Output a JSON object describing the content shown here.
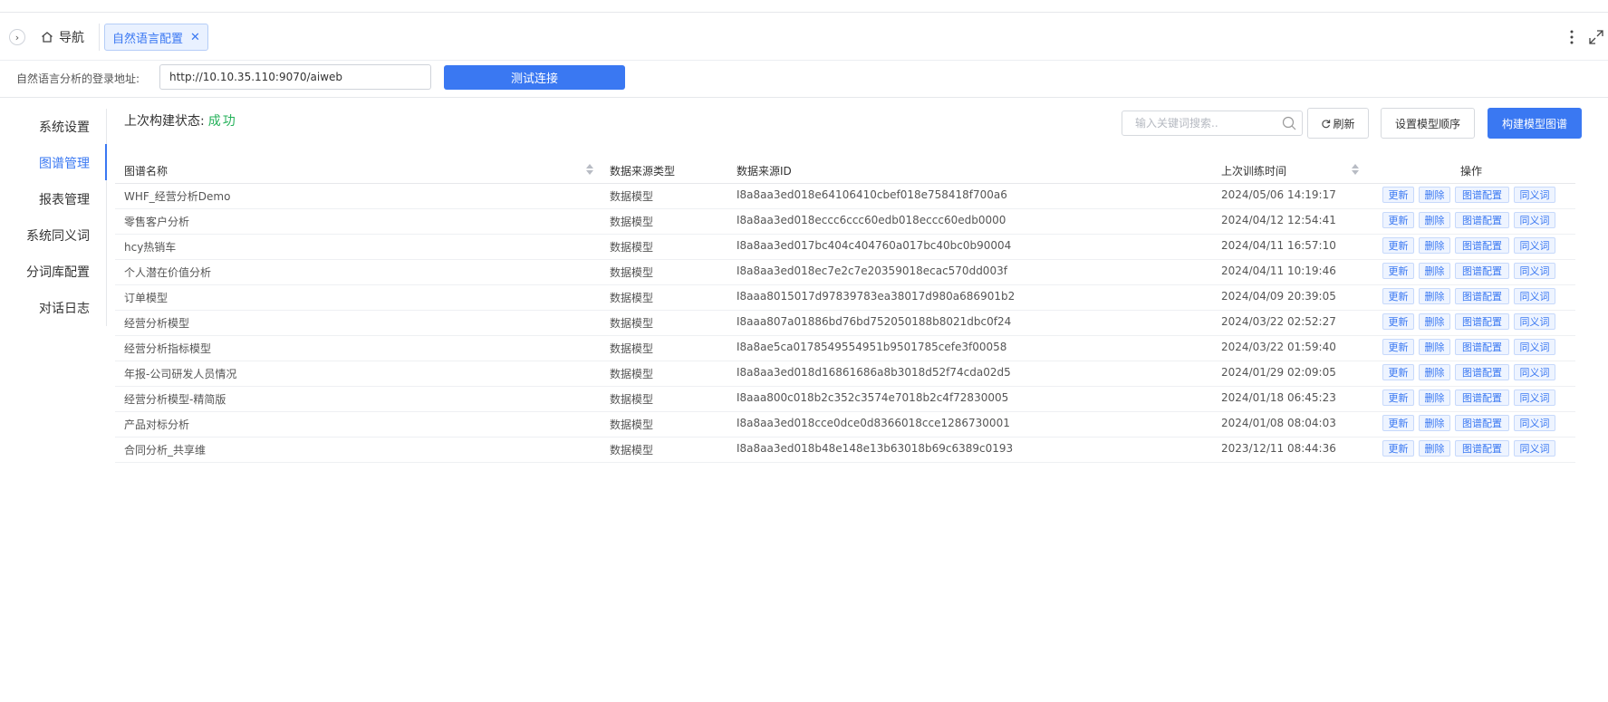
{
  "tabs": {
    "nav_label": "导航",
    "active_tab": "自然语言配置"
  },
  "url_config": {
    "label": "自然语言分析的登录地址:",
    "value": "http://10.10.35.110:9070/aiweb",
    "test_button": "测试连接"
  },
  "sidebar": {
    "items": [
      {
        "label": "系统设置",
        "active": false
      },
      {
        "label": "图谱管理",
        "active": true
      },
      {
        "label": "报表管理",
        "active": false
      },
      {
        "label": "系统同义词",
        "active": false
      },
      {
        "label": "分词库配置",
        "active": false
      },
      {
        "label": "对话日志",
        "active": false
      }
    ]
  },
  "main": {
    "status_label": "上次构建状态:",
    "status_value": "成功",
    "search_placeholder": "输入关键词搜索..",
    "refresh_label": "刷新",
    "order_label": "设置模型顺序",
    "build_label": "构建模型图谱"
  },
  "table": {
    "columns": [
      "图谱名称",
      "数据来源类型",
      "数据来源ID",
      "上次训练时间",
      "操作"
    ],
    "op_labels": [
      "更新",
      "删除",
      "图谱配置",
      "同义词"
    ],
    "rows": [
      {
        "name": "WHF_经营分析Demo",
        "type": "数据模型",
        "source_id": "I8a8aa3ed018e64106410cbef018e758418f700a6",
        "time": "2024/05/06 14:19:17"
      },
      {
        "name": "零售客户分析",
        "type": "数据模型",
        "source_id": "I8a8aa3ed018eccc6ccc60edb018eccc60edb0000",
        "time": "2024/04/12 12:54:41"
      },
      {
        "name": "hcy热销车",
        "type": "数据模型",
        "source_id": "I8a8aa3ed017bc404c404760a017bc40bc0b90004",
        "time": "2024/04/11 16:57:10"
      },
      {
        "name": "个人潜在价值分析",
        "type": "数据模型",
        "source_id": "I8a8aa3ed018ec7e2c7e20359018ecac570dd003f",
        "time": "2024/04/11 10:19:46"
      },
      {
        "name": "订单模型",
        "type": "数据模型",
        "source_id": "I8aaa8015017d97839783ea38017d980a686901b2",
        "time": "2024/04/09 20:39:05"
      },
      {
        "name": "经营分析模型",
        "type": "数据模型",
        "source_id": "I8aaa807a01886bd76bd752050188b8021dbc0f24",
        "time": "2024/03/22 02:52:27"
      },
      {
        "name": "经营分析指标模型",
        "type": "数据模型",
        "source_id": "I8a8ae5ca0178549554951b9501785cefe3f00058",
        "time": "2024/03/22 01:59:40"
      },
      {
        "name": "年报-公司研发人员情况",
        "type": "数据模型",
        "source_id": "I8a8aa3ed018d16861686a8b3018d52f74cda02d5",
        "time": "2024/01/29 02:09:05"
      },
      {
        "name": "经营分析模型-精简版",
        "type": "数据模型",
        "source_id": "I8aaa800c018b2c352c3574e7018b2c4f72830005",
        "time": "2024/01/18 06:45:23"
      },
      {
        "name": "产品对标分析",
        "type": "数据模型",
        "source_id": "I8a8aa3ed018cce0dce0d8366018cce1286730001",
        "time": "2024/01/08 08:04:03"
      },
      {
        "name": "合同分析_共享维",
        "type": "数据模型",
        "source_id": "I8a8aa3ed018b48e148e13b63018b69c6389c0193",
        "time": "2023/12/11 08:44:36"
      }
    ]
  },
  "colors": {
    "accent": "#3a78f2",
    "success": "#25b15a"
  },
  "icons": [
    "chevron-right-icon",
    "home-icon",
    "close-icon",
    "more-vertical-icon",
    "fullscreen-icon",
    "search-icon",
    "refresh-icon",
    "sort-icon"
  ]
}
